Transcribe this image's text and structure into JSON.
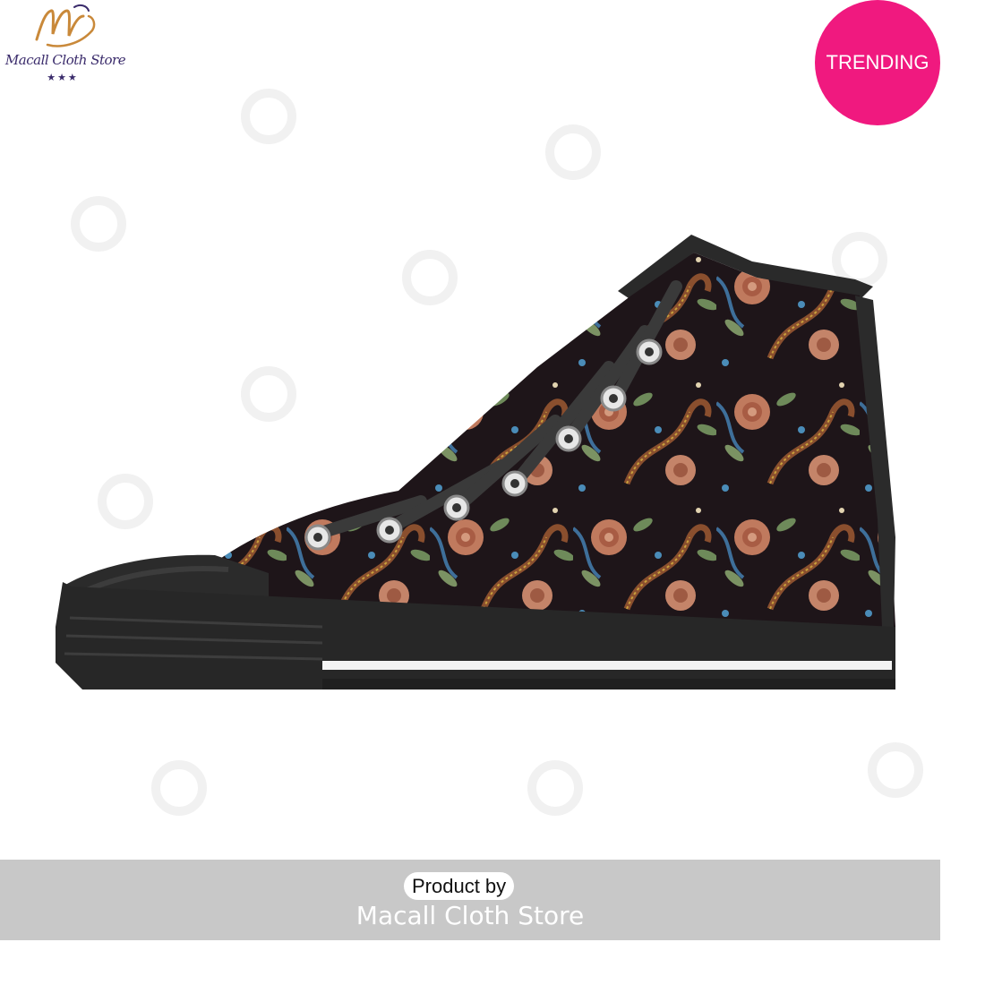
{
  "logo": {
    "text": "Macall Cloth Store",
    "stars": "★★★",
    "icon": "m-monogram-icon"
  },
  "badge": {
    "label": "TRENDING",
    "color": "#f0197f"
  },
  "product": {
    "image": "high-top-sneaker-dragon-rose-embroidery-pattern"
  },
  "footer": {
    "product_by": "Product by",
    "store_name": "Macall Cloth Store",
    "band_color": "#c8c8c8"
  }
}
